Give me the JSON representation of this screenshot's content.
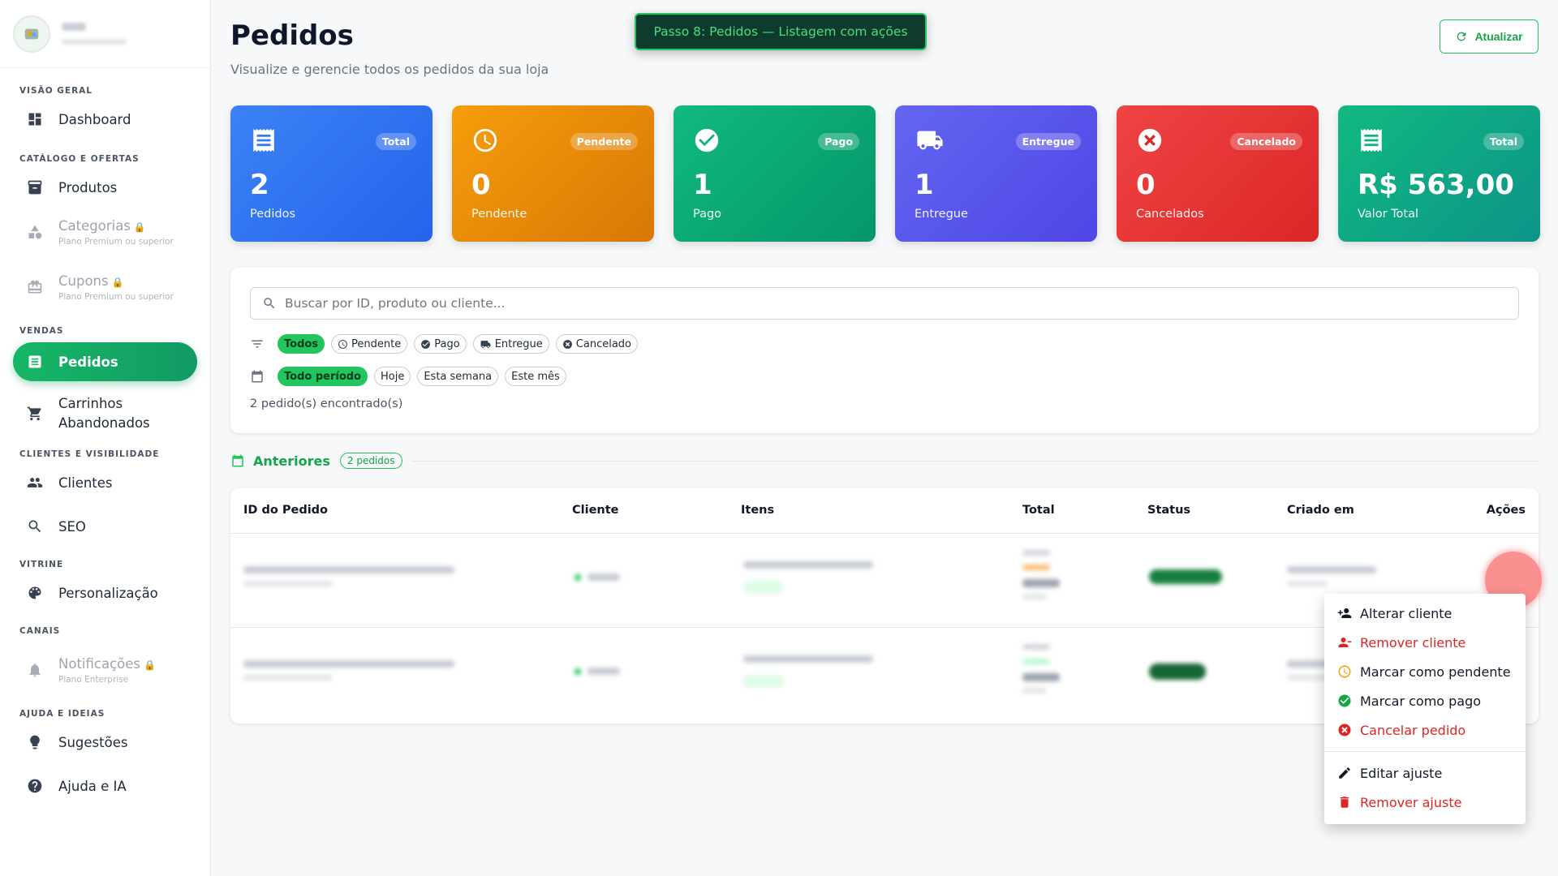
{
  "sidebar": {
    "sections": {
      "overview": "Visão geral",
      "catalog": "Catálogo e ofertas",
      "sales": "Vendas",
      "clients": "Clientes e visibilidade",
      "showcase": "Vitrine",
      "channels": "Canais",
      "help": "Ajuda e ideias"
    },
    "items": {
      "dashboard": "Dashboard",
      "produtos": "Produtos",
      "categorias": "Categorias",
      "categorias_sub": "Plano Premium ou superior",
      "cupons": "Cupons",
      "cupons_sub": "Plano Premium ou superior",
      "pedidos": "Pedidos",
      "carrinhos_1": "Carrinhos",
      "carrinhos_2": "Abandonados",
      "clientes": "Clientes",
      "seo": "SEO",
      "personalizacao": "Personalização",
      "notificacoes": "Notificações",
      "notificacoes_sub": "Plano Enterprise",
      "sugestoes": "Sugestões",
      "ajuda": "Ajuda e IA"
    }
  },
  "header": {
    "title": "Pedidos",
    "subtitle": "Visualize e gerencie todos os pedidos da sua loja",
    "step_banner": "Passo 8: Pedidos — Listagem com ações",
    "refresh_label": "Atualizar"
  },
  "cards": [
    {
      "badge": "Total",
      "value": "2",
      "caption": "Pedidos",
      "color": "#2563eb"
    },
    {
      "badge": "Pendente",
      "value": "0",
      "caption": "Pendente",
      "color": "#d97706"
    },
    {
      "badge": "Pago",
      "value": "1",
      "caption": "Pago",
      "color": "#059669"
    },
    {
      "badge": "Entregue",
      "value": "1",
      "caption": "Entregue",
      "color": "#4f46e5"
    },
    {
      "badge": "Cancelado",
      "value": "0",
      "caption": "Cancelados",
      "color": "#dc2626"
    },
    {
      "badge": "Total",
      "value": "R$ 563,00",
      "caption": "Valor Total",
      "color": "#0d9488"
    }
  ],
  "filters": {
    "search_placeholder": "Buscar por ID, produto ou cliente...",
    "status_chips": [
      "Todos",
      "Pendente",
      "Pago",
      "Entregue",
      "Cancelado"
    ],
    "period_chips": [
      "Todo período",
      "Hoje",
      "Esta semana",
      "Este mês"
    ],
    "count_text": "2 pedido(s) encontrado(s)"
  },
  "section": {
    "title": "Anteriores",
    "pill": "2 pedidos"
  },
  "table": {
    "headers": [
      "ID do Pedido",
      "Cliente",
      "Itens",
      "Total",
      "Status",
      "Criado em",
      "Ações"
    ]
  },
  "menu": {
    "items": [
      "Alterar cliente",
      "Remover cliente",
      "Marcar como pendente",
      "Marcar como pago",
      "Cancelar pedido",
      "Editar ajuste",
      "Remover ajuste"
    ]
  }
}
